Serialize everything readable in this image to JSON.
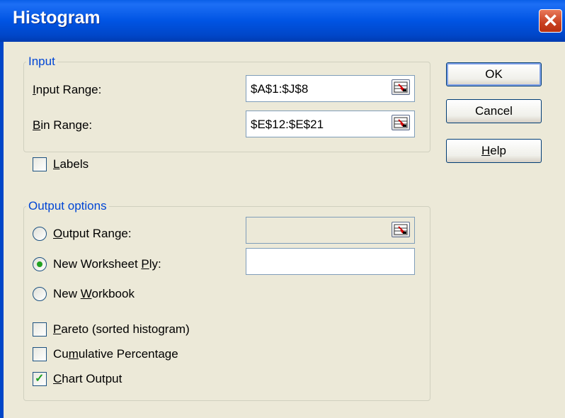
{
  "window": {
    "title": "Histogram",
    "close": "✕"
  },
  "input_group": {
    "legend": "Input",
    "input_range": {
      "label_pre": "",
      "label_u": "I",
      "label_post": "nput Range:",
      "value": "$A$1:$J$8"
    },
    "bin_range": {
      "label_pre": "",
      "label_u": "B",
      "label_post": "in Range:",
      "value": "$E$12:$E$21"
    }
  },
  "labels_check": {
    "label_pre": "",
    "label_u": "L",
    "label_post": "abels",
    "checked": false
  },
  "output_group": {
    "legend": "Output options",
    "output_range": {
      "label_pre": "",
      "label_u": "O",
      "label_post": "utput Range:",
      "value": "",
      "selected": false
    },
    "new_ply": {
      "label_pre": "New Worksheet ",
      "label_u": "P",
      "label_post": "ly:",
      "value": "",
      "selected": true
    },
    "new_workbook": {
      "label_pre": "New ",
      "label_u": "W",
      "label_post": "orkbook",
      "selected": false
    },
    "pareto": {
      "label_pre": "",
      "label_u": "P",
      "label_post": "areto (sorted histogram)",
      "checked": false
    },
    "cumulative": {
      "label_pre": "Cu",
      "label_u": "m",
      "label_post": "ulative Percentage",
      "checked": false
    },
    "chart_output": {
      "label_pre": "",
      "label_u": "C",
      "label_post": "hart Output",
      "checked": true
    }
  },
  "buttons": {
    "ok": "OK",
    "cancel": "Cancel",
    "help_pre": "",
    "help_u": "H",
    "help_post": "elp"
  },
  "marks": {
    "check": "✓"
  },
  "colors": {
    "titlebar": "#0054e3",
    "face": "#ece9d8",
    "legend": "#0046d5",
    "accent_green": "#21a121"
  }
}
